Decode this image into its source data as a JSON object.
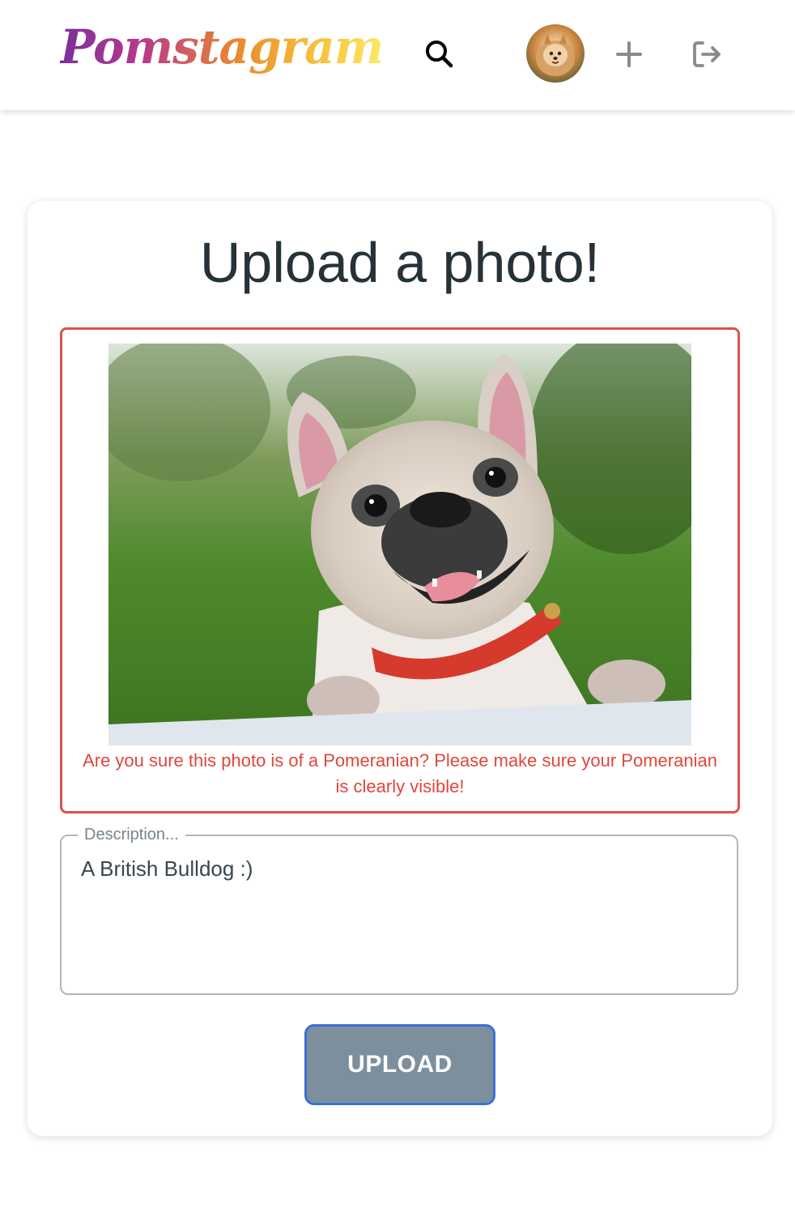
{
  "header": {
    "logo_text": "Pomstagram",
    "icons": {
      "search": "search-icon",
      "avatar": "user-avatar",
      "add": "plus-icon",
      "logout": "logout-icon"
    }
  },
  "upload_card": {
    "title": "Upload a photo!",
    "error_message": "Are you sure this photo is of a Pomeranian? Please make sure your Pomeranian is clearly visible!",
    "description_label": "Description...",
    "description_value": "A British Bulldog :)",
    "upload_button_label": "UPLOAD"
  },
  "colors": {
    "error": "#d9534f",
    "button_bg": "#7d8f9d",
    "button_focus_border": "#3b6fd6",
    "title_text": "#263238"
  }
}
